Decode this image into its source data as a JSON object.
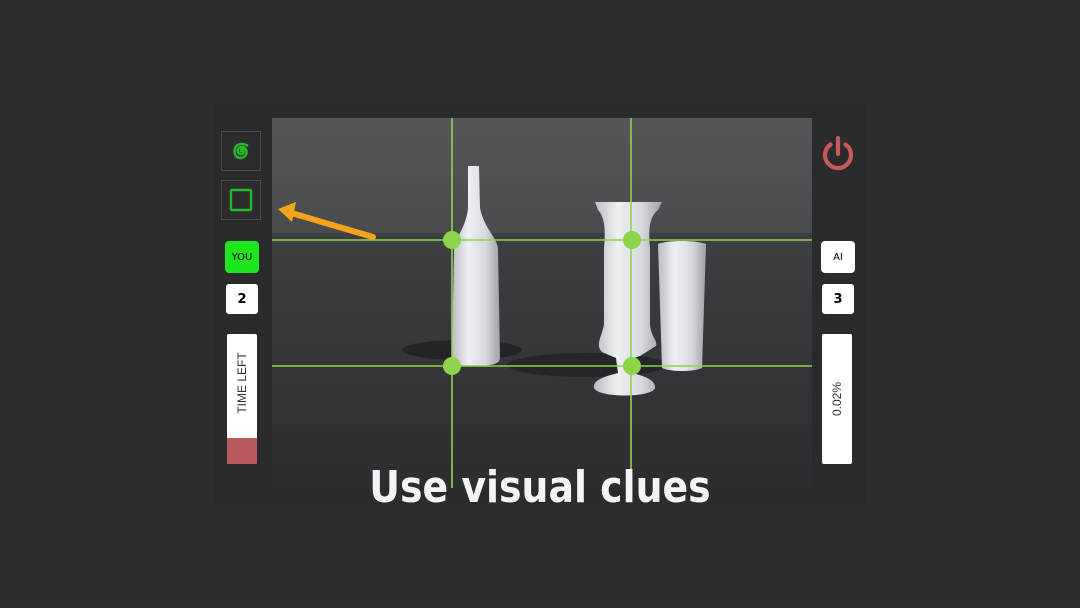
{
  "colors": {
    "accent_green": "#1ee61e",
    "grid_green": "#8ed44a",
    "power_red": "#c65a5a",
    "timer_fill": "#b8595c",
    "arrow_orange": "#f5a31a"
  },
  "toolbar": {
    "spiral_icon": "spiral-icon",
    "square_icon": "square-icon"
  },
  "player": {
    "label": "YOU",
    "score": "2",
    "timer_label": "TIME LEFT",
    "time_left_fraction": 0.2
  },
  "opponent": {
    "label": "AI",
    "score": "3",
    "percent_label": "0.02%"
  },
  "power_icon": "power-icon",
  "caption": "Use visual clues"
}
